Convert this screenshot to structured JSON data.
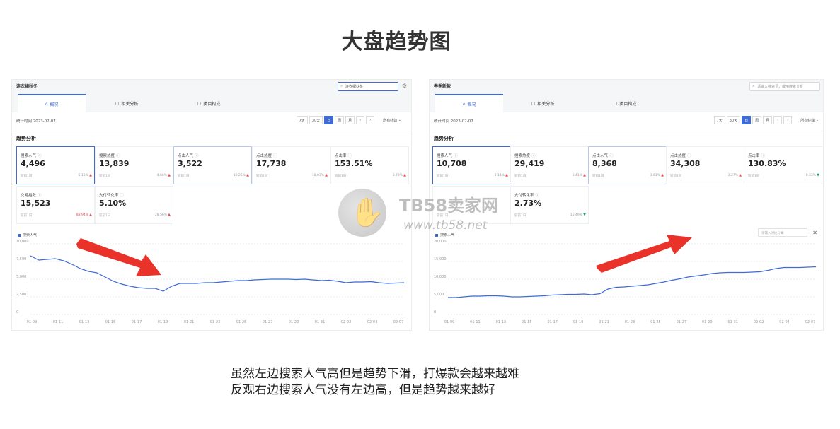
{
  "page": {
    "title": "大盘趋势图"
  },
  "watermark": {
    "brand": "TB58卖家网",
    "url": "www.tb58.net"
  },
  "caption": {
    "line1": "虽然左边搜索人气高但是趋势下滑，打爆款会越来越难",
    "line2": "反观右边搜索人气没有左边高，但是趋势越来越好"
  },
  "colors": {
    "accent": "#3f6bd6",
    "arrow": "#e8322a",
    "up": "#e5484d",
    "down": "#1aa260"
  },
  "left": {
    "name": "连衣裙秋冬",
    "search_value": "连衣裙秋冬",
    "tabs": [
      "概况",
      "相关分析",
      "类目构成"
    ],
    "stat_date": "统计时间 2023-02-07",
    "range_buttons": [
      "7天",
      "30天",
      "日",
      "周",
      "月"
    ],
    "terminal": "所有终端",
    "section": "趋势分析",
    "metrics": [
      {
        "name": "搜索人气",
        "value": "4,496",
        "cmp": "较前1日",
        "change": "5.15%",
        "dir": "up"
      },
      {
        "name": "搜索热度",
        "value": "13,839",
        "cmp": "较前1日",
        "change": "4.66%",
        "dir": "up"
      },
      {
        "name": "点击人气",
        "value": "3,522",
        "cmp": "较前1日",
        "change": "10.25%",
        "dir": "up"
      },
      {
        "name": "点击热度",
        "value": "17,738",
        "cmp": "较前1日",
        "change": "18.03%",
        "dir": "up"
      },
      {
        "name": "点击率",
        "value": "153.51%",
        "cmp": "较前1日",
        "change": "6.79%",
        "dir": "up"
      },
      {
        "name": "交易指数",
        "value": "15,523",
        "cmp": "较前1日",
        "change": "88.94%",
        "dir": "up"
      },
      {
        "name": "支付转化率",
        "value": "5.10%",
        "cmp": "较前1日",
        "change": "28.56%",
        "dir": "up"
      }
    ],
    "legend": "搜索人气"
  },
  "right": {
    "name": "春季新款",
    "search_placeholder": "请输入搜索词，或用搜索分析",
    "tabs": [
      "概况",
      "相关分析",
      "类目构成"
    ],
    "stat_date": "统计时间 2023-02-07",
    "range_buttons": [
      "7天",
      "30天",
      "日",
      "周",
      "月"
    ],
    "terminal": "所有终端",
    "section": "趋势分析",
    "metrics": [
      {
        "name": "搜索人气",
        "value": "10,708",
        "cmp": "较前1日",
        "change": "2.14%",
        "dir": "up"
      },
      {
        "name": "搜索热度",
        "value": "29,419",
        "cmp": "较前1日",
        "change": "3.41%",
        "dir": "up"
      },
      {
        "name": "点击人气",
        "value": "8,368",
        "cmp": "较前1日",
        "change": "3.61%",
        "dir": "up"
      },
      {
        "name": "点击热度",
        "value": "34,308",
        "cmp": "较前1日",
        "change": "3.27%",
        "dir": "up"
      },
      {
        "name": "点击率",
        "value": "130.83%",
        "cmp": "较前1日",
        "change": "0.33%",
        "dir": "down"
      },
      {
        "name": "",
        "value": "",
        "cmp": "较前1日",
        "change": "",
        "dir": ""
      },
      {
        "name": "支付转化率",
        "value": "2.73%",
        "cmp": "较前1日",
        "change": "15.49%",
        "dir": "down"
      }
    ],
    "legend": "搜索人气",
    "trend_search_placeholder": "请输入对比分类"
  },
  "chart_data": [
    {
      "type": "line",
      "title": "",
      "series": [
        {
          "name": "搜索人气",
          "values": [
            8300,
            7700,
            7800,
            7900,
            7600,
            7100,
            6500,
            6100,
            5900,
            5300,
            4700,
            4300,
            4000,
            3800,
            3700,
            3700,
            3300,
            4000,
            4400,
            4400,
            4400,
            4500,
            4500,
            4600,
            4700,
            4800,
            4800,
            4900,
            4950,
            5000,
            5000,
            5000,
            4950,
            5000,
            4900,
            4800,
            4850,
            4700,
            4500,
            4600,
            4600,
            4650,
            4500,
            4400,
            4450,
            4500
          ]
        }
      ],
      "x_ticks": [
        "01-09",
        "01-11",
        "01-13",
        "01-15",
        "01-17",
        "01-19",
        "01-21",
        "01-23",
        "01-25",
        "01-27",
        "01-29",
        "01-31",
        "02-02",
        "02-04",
        "02-07"
      ],
      "y_ticks": [
        "0",
        "2,500",
        "5,000",
        "7,500",
        "10,000"
      ],
      "ylim": [
        0,
        10000
      ],
      "grid": true
    },
    {
      "type": "line",
      "title": "",
      "series": [
        {
          "name": "搜索人气",
          "values": [
            4800,
            4800,
            5000,
            5200,
            5200,
            5300,
            5300,
            5200,
            5000,
            5000,
            5100,
            5200,
            5300,
            5500,
            5600,
            5700,
            5700,
            5800,
            5600,
            5900,
            7200,
            7700,
            7800,
            8000,
            8200,
            8400,
            8800,
            9200,
            9700,
            10100,
            10600,
            10900,
            11200,
            11600,
            11800,
            11900,
            11900,
            11900,
            12000,
            12100,
            12500,
            13000,
            13300,
            13300,
            13300,
            13400,
            13500
          ]
        }
      ],
      "x_ticks": [
        "01-09",
        "01-11",
        "01-13",
        "01-15",
        "01-17",
        "01-19",
        "01-21",
        "01-23",
        "01-25",
        "01-27",
        "01-29",
        "01-31",
        "02-02",
        "02-04",
        "02-07"
      ],
      "y_ticks": [
        "0",
        "5,000",
        "10,000",
        "15,000",
        "20,000"
      ],
      "ylim": [
        0,
        20000
      ],
      "grid": true
    }
  ]
}
